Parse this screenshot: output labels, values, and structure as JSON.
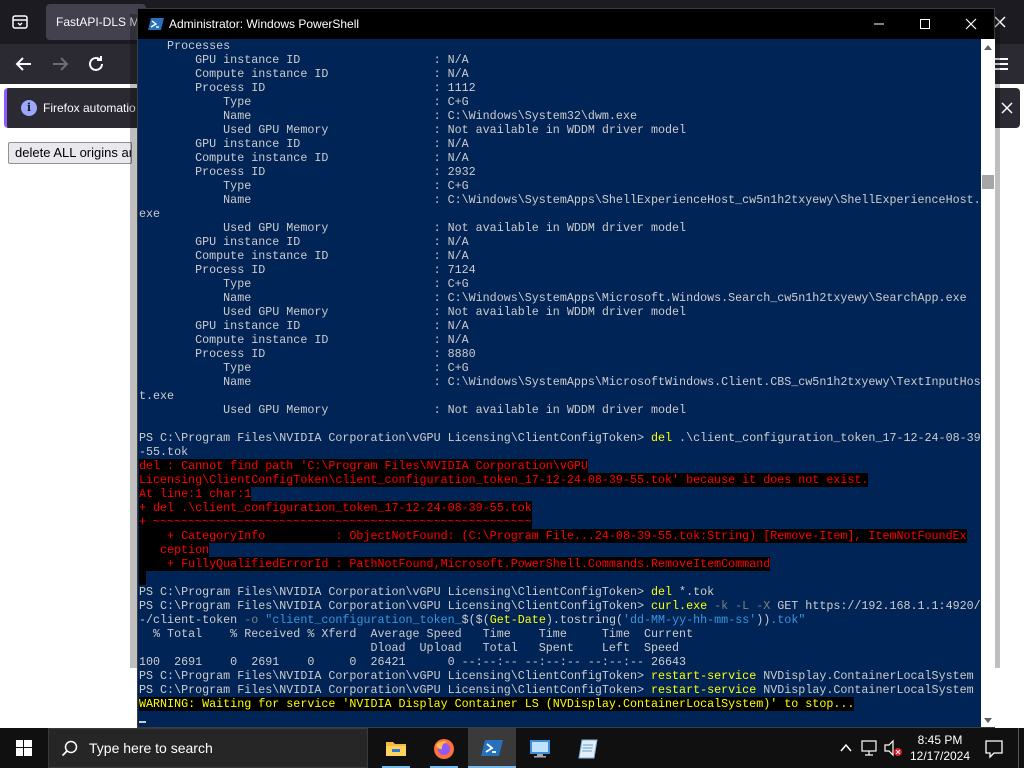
{
  "firefox": {
    "tab_title": "FastAPI-DLS Ma",
    "infobar_text": "Firefox automatio",
    "page_button": "delete ALL origins ar"
  },
  "powershell": {
    "title": "Administrator: Windows PowerShell",
    "lines": [
      {
        "text": "    Processes"
      },
      {
        "text": "        GPU instance ID                   : N/A"
      },
      {
        "text": "        Compute instance ID               : N/A"
      },
      {
        "text": "        Process ID                        : 1112"
      },
      {
        "text": "            Type                          : C+G"
      },
      {
        "text": "            Name                          : C:\\Windows\\System32\\dwm.exe"
      },
      {
        "text": "            Used GPU Memory               : Not available in WDDM driver model"
      },
      {
        "text": "        GPU instance ID                   : N/A"
      },
      {
        "text": "        Compute instance ID               : N/A"
      },
      {
        "text": "        Process ID                        : 2932"
      },
      {
        "text": "            Type                          : C+G"
      },
      {
        "text": "            Name                          : C:\\Windows\\SystemApps\\ShellExperienceHost_cw5n1h2txyewy\\ShellExperienceHost."
      },
      {
        "text": "exe"
      },
      {
        "text": "            Used GPU Memory               : Not available in WDDM driver model"
      },
      {
        "text": "        GPU instance ID                   : N/A"
      },
      {
        "text": "        Compute instance ID               : N/A"
      },
      {
        "text": "        Process ID                        : 7124"
      },
      {
        "text": "            Type                          : C+G"
      },
      {
        "text": "            Name                          : C:\\Windows\\SystemApps\\Microsoft.Windows.Search_cw5n1h2txyewy\\SearchApp.exe"
      },
      {
        "text": "            Used GPU Memory               : Not available in WDDM driver model"
      },
      {
        "text": "        GPU instance ID                   : N/A"
      },
      {
        "text": "        Compute instance ID               : N/A"
      },
      {
        "text": "        Process ID                        : 8880"
      },
      {
        "text": "            Type                          : C+G"
      },
      {
        "text": "            Name                          : C:\\Windows\\SystemApps\\MicrosoftWindows.Client.CBS_cw5n1h2txyewy\\TextInputHos"
      },
      {
        "text": "t.exe"
      },
      {
        "text": "            Used GPU Memory               : Not available in WDDM driver model"
      },
      {
        "text": ""
      },
      {
        "segments": [
          {
            "t": "PS C:\\Program Files\\NVIDIA Corporation\\vGPU Licensing\\ClientConfigToken> "
          },
          {
            "t": "del",
            "c": "y"
          },
          {
            "t": " .\\client_configuration_token_17-12-24-08-39"
          }
        ]
      },
      {
        "text": "-55.tok"
      },
      {
        "text": "del : Cannot find path 'C:\\Program Files\\NVIDIA Corporation\\vGPU",
        "style": "err"
      },
      {
        "text": "Licensing\\ClientConfigToken\\client_configuration_token_17-12-24-08-39-55.tok' because it does not exist.",
        "style": "err"
      },
      {
        "text": "At line:1 char:1",
        "style": "err"
      },
      {
        "text": "+ del .\\client_configuration_token_17-12-24-08-39-55.tok",
        "style": "err"
      },
      {
        "text": "+ ~~~~~~~~~~~~~~~~~~~~~~~~~~~~~~~~~~~~~~~~~~~~~~~~~~~~~~",
        "style": "err"
      },
      {
        "text": "    + CategoryInfo          : ObjectNotFound: (C:\\Program File...24-08-39-55.tok:String) [Remove-Item], ItemNotFoundEx",
        "style": "err"
      },
      {
        "text": "   ception",
        "style": "err"
      },
      {
        "text": "    + FullyQualifiedErrorId : PathNotFound,Microsoft.PowerShell.Commands.RemoveItemCommand",
        "style": "err"
      },
      {
        "text": " ",
        "style": "err"
      },
      {
        "segments": [
          {
            "t": "PS C:\\Program Files\\NVIDIA Corporation\\vGPU Licensing\\ClientConfigToken> "
          },
          {
            "t": "del",
            "c": "y"
          },
          {
            "t": " *.tok"
          }
        ]
      },
      {
        "segments": [
          {
            "t": "PS C:\\Program Files\\NVIDIA Corporation\\vGPU Licensing\\ClientConfigToken> "
          },
          {
            "t": "curl.exe",
            "c": "y"
          },
          {
            "t": " "
          },
          {
            "t": "-k -L -X",
            "c": "g"
          },
          {
            "t": " GET https://192.168.1.1:4920/"
          }
        ]
      },
      {
        "segments": [
          {
            "t": "-/client-token "
          },
          {
            "t": "-o",
            "c": "g"
          },
          {
            "t": " "
          },
          {
            "t": "\"client_configuration_token_",
            "c": "dc"
          },
          {
            "t": "$($("
          },
          {
            "t": "Get-Date",
            "c": "y"
          },
          {
            "t": ").tostring("
          },
          {
            "t": "'dd-MM-yy-hh-mm-ss'",
            "c": "dc"
          },
          {
            "t": "))"
          },
          {
            "t": ".tok\"",
            "c": "dc"
          }
        ]
      },
      {
        "text": "  % Total    % Received % Xferd  Average Speed   Time    Time     Time  Current"
      },
      {
        "text": "                                 Dload  Upload   Total   Spent    Left  Speed"
      },
      {
        "text": "100  2691    0  2691    0     0  26421      0 --:--:-- --:--:-- --:--:-- 26643"
      },
      {
        "segments": [
          {
            "t": "PS C:\\Program Files\\NVIDIA Corporation\\vGPU Licensing\\ClientConfigToken> "
          },
          {
            "t": "restart-service",
            "c": "y"
          },
          {
            "t": " NVDisplay.ContainerLocalSystem"
          }
        ]
      },
      {
        "segments": [
          {
            "t": "PS C:\\Program Files\\NVIDIA Corporation\\vGPU Licensing\\ClientConfigToken> "
          },
          {
            "t": "restart-service",
            "c": "y"
          },
          {
            "t": " NVDisplay.ContainerLocalSystem"
          }
        ]
      },
      {
        "text": "WARNING: Waiting for service 'NVIDIA Display Container LS (NVDisplay.ContainerLocalSystem)' to stop...",
        "style": "warn"
      }
    ]
  },
  "taskbar": {
    "search_placeholder": "Type here to search",
    "apps": [
      "file-explorer",
      "firefox",
      "powershell",
      "remote-desktop",
      "notepad"
    ],
    "time": "8:45 PM",
    "date": "12/17/2024"
  }
}
